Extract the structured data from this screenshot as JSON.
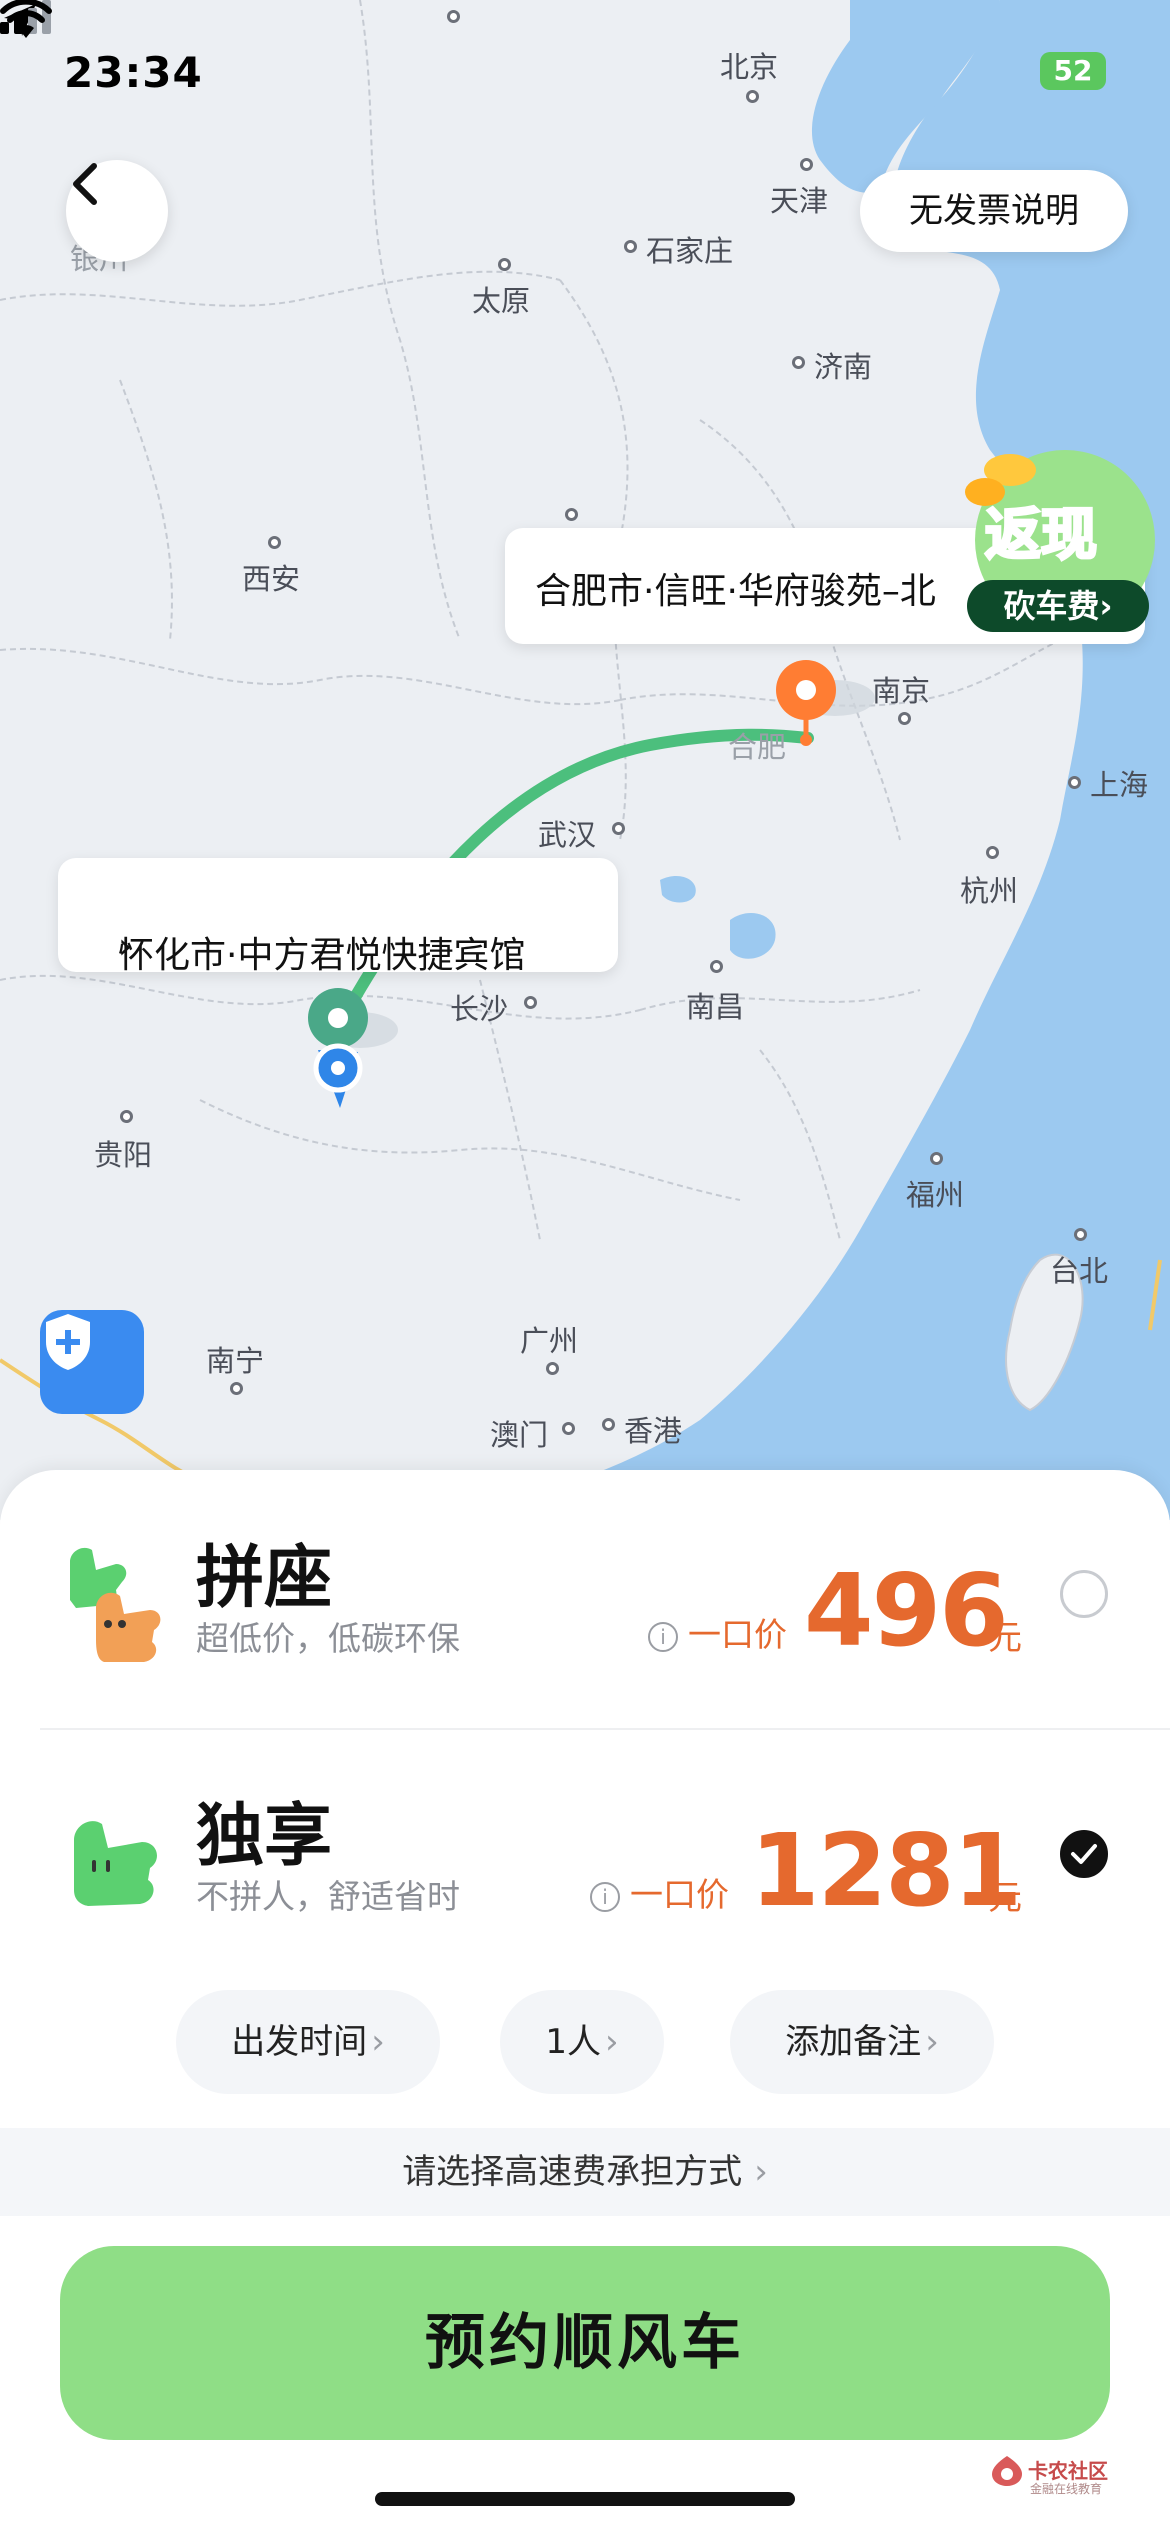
{
  "status_bar": {
    "time": "23:34",
    "battery": "52"
  },
  "header": {
    "invoice_button": "无发票说明"
  },
  "map": {
    "cities": {
      "beijing": "北京",
      "tianjin": "天津",
      "shijiazhuang": "石家庄",
      "taiyuan": "太原",
      "jinan": "济南",
      "xian": "西安",
      "nanjing": "南京",
      "hefei": "合肥",
      "wuhan": "武汉",
      "shanghai": "上海",
      "hangzhou": "杭州",
      "changsha": "长沙",
      "nanchang": "南昌",
      "guiyang": "贵阳",
      "fuzhou": "福州",
      "taibei": "台北",
      "nanning": "南宁",
      "guangzhou": "广州",
      "macau": "澳门",
      "hongkong": "香港",
      "yinchuan": "银川"
    },
    "destination_label": "合肥市·信旺·华府骏苑–北",
    "origin_label": "怀化市·中方君悦快捷宾馆",
    "origin_chevron": "›",
    "cashback": {
      "title": "返现",
      "subtitle": "砍车费"
    }
  },
  "options": [
    {
      "title": "拼座",
      "subtitle": "超低价，低碳环保",
      "price_label": "一口价",
      "price": "496",
      "unit": "元",
      "selected": false
    },
    {
      "title": "独享",
      "subtitle": "不拼人，舒适省时",
      "price_label": "一口价",
      "price": "1281",
      "unit": "元",
      "selected": true
    }
  ],
  "chips": {
    "departure": "出发时间",
    "passengers": "1人",
    "note": "添加备注",
    "chevron": "›"
  },
  "toll": {
    "label": "请选择高速费承担方式",
    "chevron": "›"
  },
  "cta": {
    "label": "预约顺风车"
  },
  "watermark": {
    "title": "卡农社区",
    "subtitle": "金融在线教育"
  },
  "colors": {
    "accent_green": "#8fde86",
    "price_orange": "#e5692e",
    "route_green": "#4cbf7d",
    "sea_blue": "#9cc9f0"
  }
}
